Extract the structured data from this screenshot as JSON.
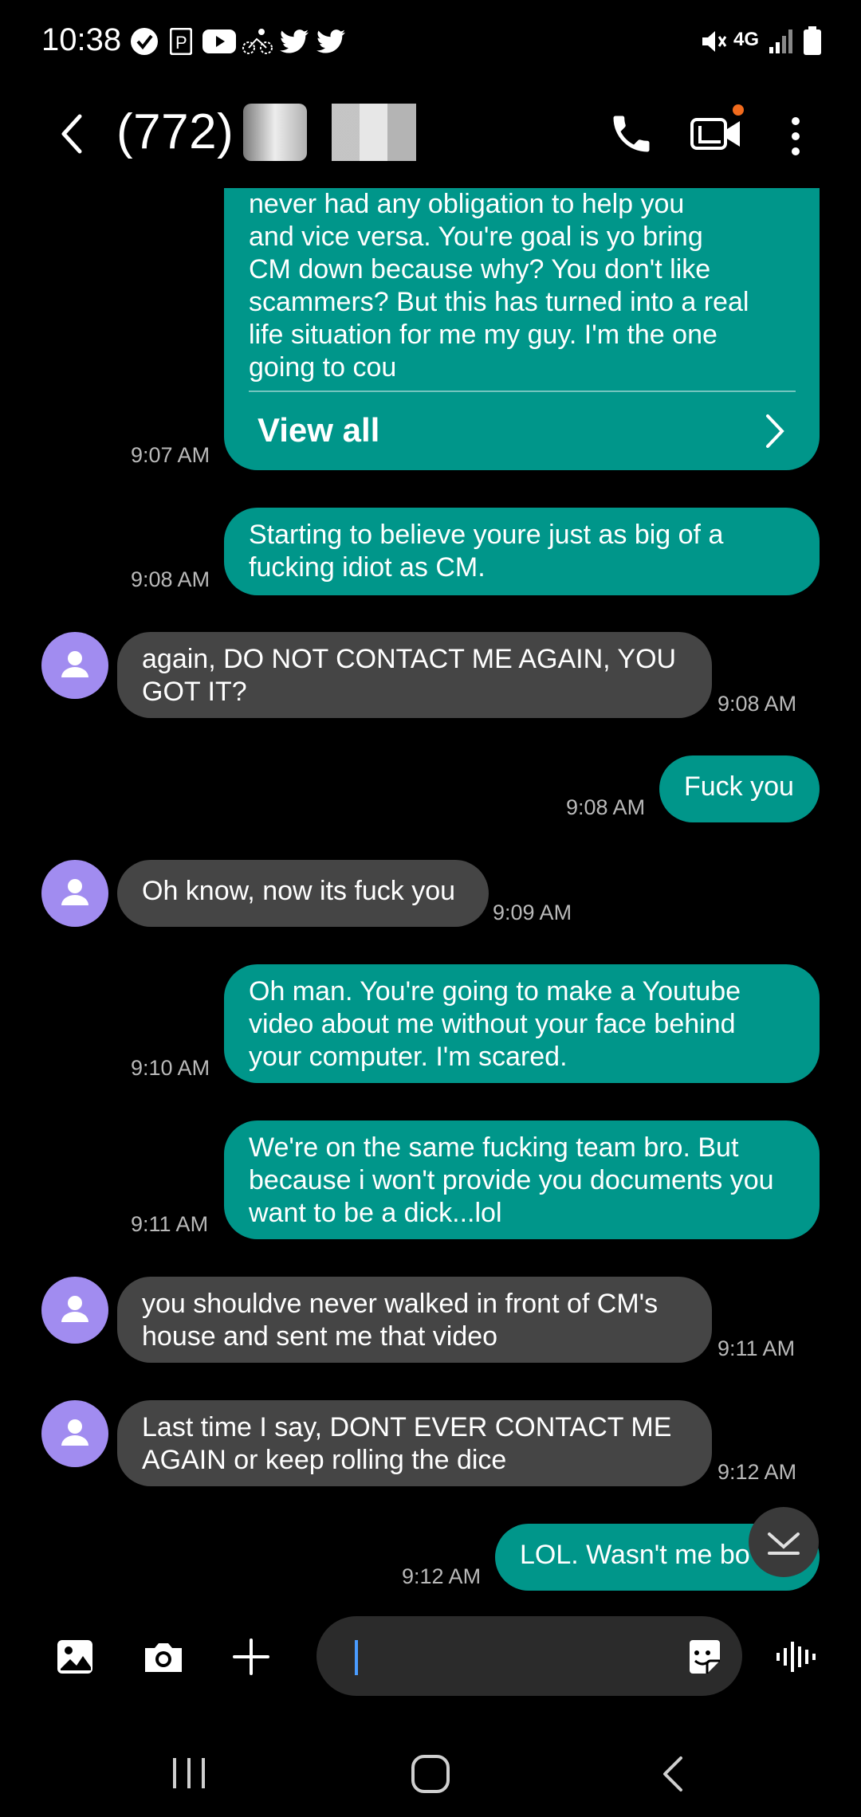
{
  "status_bar": {
    "time": "10:38",
    "network": "4G"
  },
  "header": {
    "contact": "(772) 6",
    "icons": [
      "back-icon",
      "phone-icon",
      "video-call-icon",
      "more-options-icon"
    ]
  },
  "messages": [
    {
      "type": "sent",
      "lines": [
        "never had any obligation to help you",
        "and vice versa.  You're goal is yo bring",
        "CM down because why?  You don't like",
        "scammers?  But this has turned into a real",
        "life situation for me my guy.  I'm the one",
        "going to cou"
      ],
      "time": "9:07 AM",
      "view_all": "View all"
    },
    {
      "type": "sent",
      "lines": [
        "Starting to believe youre just as big of a",
        "fucking idiot as CM."
      ],
      "time": "9:08 AM"
    },
    {
      "type": "received",
      "lines": [
        "again, DO NOT CONTACT ME AGAIN, YOU",
        "GOT IT?"
      ],
      "time": "9:08 AM"
    },
    {
      "type": "sent",
      "lines": [
        "Fuck you"
      ],
      "time": "9:08 AM"
    },
    {
      "type": "received",
      "lines": [
        "Oh know, now its fuck you"
      ],
      "time": "9:09 AM"
    },
    {
      "type": "sent",
      "lines": [
        "Oh man. You're going to make a Youtube",
        "video about me without your face behind",
        "your computer.  I'm scared."
      ],
      "time": "9:10 AM"
    },
    {
      "type": "sent",
      "lines": [
        "We're on the same fucking team bro.  But",
        "because i won't provide you documents you",
        "want to be a dick...lol"
      ],
      "time": "9:11 AM"
    },
    {
      "type": "received",
      "lines": [
        "you shouldve never walked in front of CM's",
        "house and sent me that video"
      ],
      "time": "9:11 AM"
    },
    {
      "type": "received",
      "lines": [
        "Last time I say, DONT EVER CONTACT ME",
        "AGAIN or keep rolling the dice"
      ],
      "time": "9:12 AM"
    },
    {
      "type": "sent",
      "lines": [
        "LOL. Wasn't me bo"
      ],
      "time": "9:12 AM"
    }
  ],
  "composer": {
    "placeholder": "",
    "icons": [
      "gallery-icon",
      "camera-icon",
      "add-icon",
      "sticker-icon",
      "voice-icon"
    ]
  },
  "nav_bar": [
    "recents-icon",
    "home-icon",
    "back-nav-icon"
  ]
}
